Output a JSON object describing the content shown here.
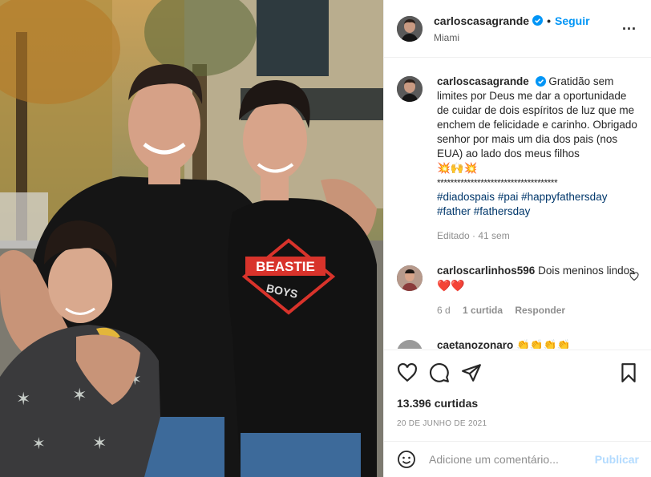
{
  "photo": {
    "shirt_text_1": "BEASTIE",
    "shirt_text_2": "BOYS"
  },
  "header": {
    "username": "carloscasagrande",
    "follow_label": "Seguir",
    "separator": "•",
    "location": "Miami",
    "more_label": "...",
    "icons": {
      "verified": "verified-badge-icon",
      "more": "more-options-icon"
    }
  },
  "caption": {
    "username": "carloscasagrande",
    "text": "Gratidão sem limites por Deus me dar a oportunidade de cuidar de dois espíritos de luz que me enchem de felicidade e carinho. Obrigado senhor por mais um dia dos pais (nos EUA) ao lado dos meus filhos",
    "emojis": "💥🙌💥",
    "stars": "************************************",
    "hashtags": [
      "#diadospais",
      "#pai",
      "#happyfathersday",
      "#father",
      "#fathersday"
    ],
    "edited": "Editado · 41 sem"
  },
  "comment1": {
    "username": "carloscarlinhos596",
    "text": "Dois meninos lindos",
    "hearts": "❤️❤️",
    "time": "6 d",
    "likes": "1 curtida",
    "reply": "Responder"
  },
  "comment2": {
    "username": "caetanozonaro",
    "text": "👏👏👏👏"
  },
  "actions": {
    "icons": [
      "heart-icon",
      "comment-icon",
      "share-icon",
      "save-icon"
    ],
    "likes": "13.396 curtidas",
    "date": "20 DE JUNHO DE 2021"
  },
  "add_comment": {
    "placeholder": "Adicione um comentário...",
    "publish_label": "Publicar",
    "icon": "emoji-icon"
  },
  "colors": {
    "accent": "#0095f6",
    "link": "#00376b",
    "muted": "#8e8e8e",
    "heart": "#ed4956",
    "publish_disabled": "#b3dbff"
  }
}
